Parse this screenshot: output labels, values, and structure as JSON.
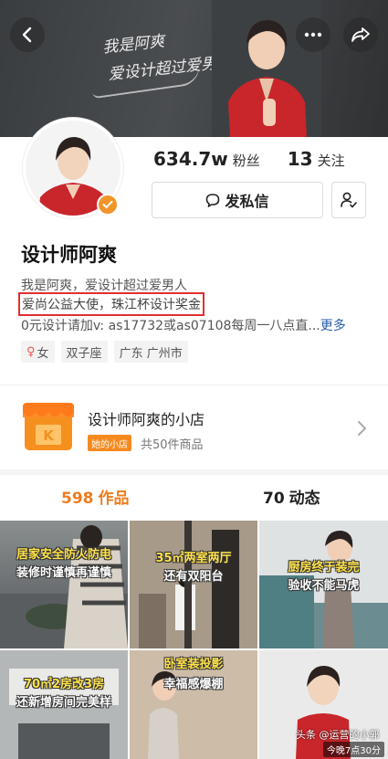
{
  "banner": {
    "line1": "我是阿爽",
    "line2": "爱设计超过爱男人"
  },
  "header": {
    "back_icon": "chevron-left-icon",
    "more_icon": "more-dots-icon",
    "share_icon": "share-arrow-icon"
  },
  "profile": {
    "followers_count": "634.7w",
    "followers_label": "粉丝",
    "following_count": "13",
    "following_label": "关注",
    "message_label": "发私信",
    "name": "设计师阿爽",
    "bio_line1": "我是阿爽，爱设计超过爱男人",
    "bio_line2": "爱尚公益大使，珠江杯设计奖金",
    "bio_line3": "0元设计请加v: as17732或as07108每周一八点直...",
    "more_label": "更多",
    "tags": {
      "gender_symbol": "♀",
      "gender": "女",
      "zodiac": "双子座",
      "location": "广东 广州市"
    }
  },
  "shop": {
    "name": "设计师阿爽的小店",
    "badge": "她的小店",
    "count": "共50件商品"
  },
  "tabs": {
    "works_count": "598",
    "works_label": "作品",
    "posts_count": "70",
    "posts_label": "动态"
  },
  "grid": {
    "tile1_caption_a": "居家安全防火防电",
    "tile1_caption_b": "装修时谨慎再谨慎",
    "tile2_caption_a": "35㎡两室两厅",
    "tile2_caption_b": "还有双阳台",
    "tile3_caption_a": "厨房终于装完",
    "tile3_caption_b": "验收不能马虎",
    "tile4_caption_a": "70㎡2房改3房",
    "tile4_caption_b": "还新增房间完美样",
    "tile5_caption_a": "卧室装投影",
    "tile5_caption_b": "幸福感爆棚",
    "tile6_watermark": "头条 @运营的小郭",
    "tile6_time": "今晚7点30分"
  },
  "colors": {
    "accent_orange": "#ef7c1c",
    "highlight_red": "#e0302f",
    "link_blue": "#2a5db0"
  }
}
